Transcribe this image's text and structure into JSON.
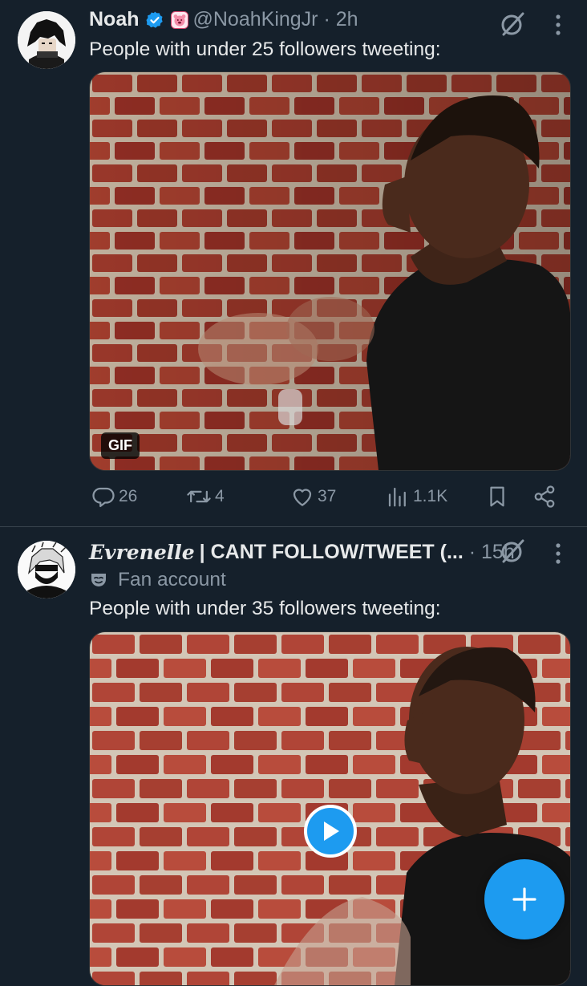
{
  "colors": {
    "background": "#15202b",
    "accent": "#1d9bf0",
    "text": "#e7e9ea",
    "muted": "#8b98a5"
  },
  "tweets": [
    {
      "display_name": "Noah",
      "handle": "@NoahKingJr",
      "time": "2h",
      "text": "People with under 25 followers tweeting:",
      "media_badge": "GIF",
      "stats": {
        "replies": "26",
        "retweets": "4",
        "likes": "37",
        "views": "1.1K"
      },
      "icons": [
        "verified-badge-icon",
        "affiliate-badge-icon",
        "grok-icon",
        "more-icon",
        "reply-icon",
        "retweet-icon",
        "like-icon",
        "views-icon",
        "bookmark-icon",
        "share-icon"
      ]
    },
    {
      "display_name": "Evrenelle",
      "name_suffix": "| CANT FOLLOW/TWEET (...",
      "time": "15h",
      "label": "Fan account",
      "text": "People with under 35 followers tweeting:",
      "icons": [
        "fan-mask-icon",
        "grok-icon",
        "more-icon",
        "play-icon"
      ]
    }
  ],
  "fab": {
    "icon": "compose-plus-icon"
  }
}
